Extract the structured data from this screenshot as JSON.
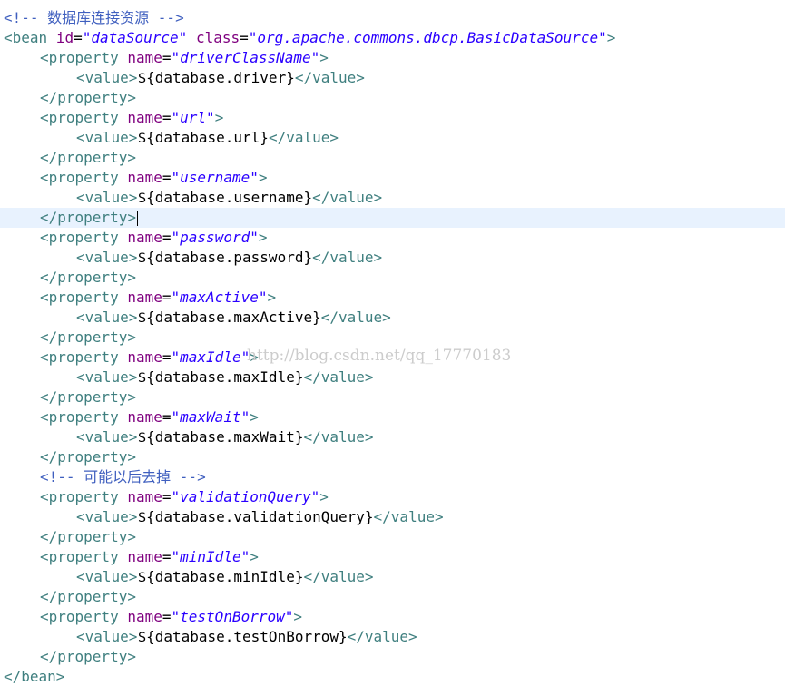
{
  "comment_top": "<!-- 数据库连接资源 -->",
  "bean": {
    "open_tag": "<bean",
    "id_attr": "id",
    "id_val": "\"dataSource\"",
    "class_attr": "class",
    "class_val": "\"org.apache.commons.dbcp.BasicDataSource\"",
    "gt": ">",
    "close_tag": "</bean>"
  },
  "syntax": {
    "property_open": "<property",
    "name_attr": "name",
    "eq": "=",
    "gt": ">",
    "value_open": "<value>",
    "value_close": "</value>",
    "property_close": "</property>"
  },
  "properties": [
    {
      "name": "\"driverClassName\"",
      "value": "${database.driver}"
    },
    {
      "name": "\"url\"",
      "value": "${database.url}"
    },
    {
      "name": "\"username\"",
      "value": "${database.username}"
    },
    {
      "name": "\"password\"",
      "value": "${database.password}"
    },
    {
      "name": "\"maxActive\"",
      "value": "${database.maxActive}"
    },
    {
      "name": "\"maxIdle\"",
      "value": "${database.maxIdle}"
    },
    {
      "name": "\"maxWait\"",
      "value": "${database.maxWait}"
    },
    {
      "name": "\"validationQuery\"",
      "value": "${database.validationQuery}"
    },
    {
      "name": "\"minIdle\"",
      "value": "${database.minIdle}"
    },
    {
      "name": "\"testOnBorrow\"",
      "value": "${database.testOnBorrow}"
    }
  ],
  "comment_mid": "<!-- 可能以后去掉 -->",
  "watermark": "http://blog.csdn.net/qq_17770183",
  "colors": {
    "tag": "#3f7f7f",
    "attribute": "#7f007f",
    "string": "#2a00ff",
    "comment": "#3f5fbf",
    "highlight": "#e8f2fe"
  }
}
